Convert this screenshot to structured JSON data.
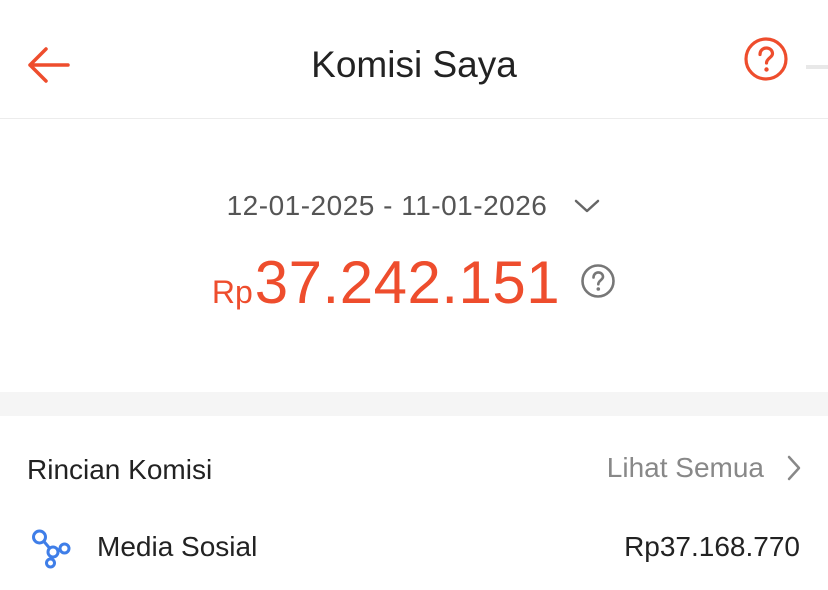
{
  "header": {
    "title": "Komisi Saya",
    "back_icon": "arrow-left-icon",
    "help_icon": "question-circle-icon"
  },
  "summary": {
    "date_range": "12-01-2025 - 11-01-2026",
    "amount_prefix": "Rp",
    "amount_value": "37.242.151"
  },
  "details": {
    "title": "Rincian Komisi",
    "see_all_label": "Lihat Semua",
    "items": [
      {
        "icon": "share-network-icon",
        "label": "Media Sosial",
        "value": "Rp37.168.770"
      }
    ]
  },
  "colors": {
    "accent": "#ee4d2d",
    "text_primary": "#222222",
    "text_secondary": "#888888",
    "icon_blue": "#3f7ee8"
  }
}
